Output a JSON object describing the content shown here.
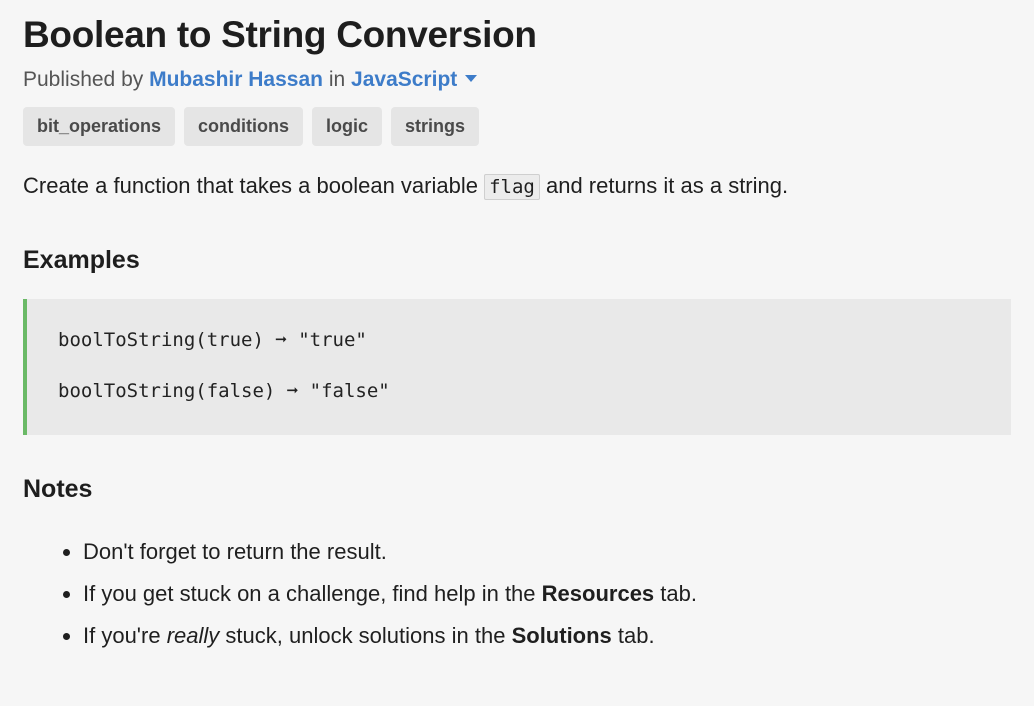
{
  "challenge": {
    "title": "Boolean to String Conversion",
    "published_prefix": "Published by",
    "author": "Mubashir Hassan",
    "in_word": "in",
    "language": "JavaScript",
    "tags": [
      "bit_operations",
      "conditions",
      "logic",
      "strings"
    ],
    "description_before": "Create a function that takes a boolean variable",
    "description_code": "flag",
    "description_after": "and returns it as a string."
  },
  "examples": {
    "heading": "Examples",
    "lines": [
      "boolToString(true) ➞ \"true\"",
      "boolToString(false) ➞ \"false\""
    ]
  },
  "notes": {
    "heading": "Notes",
    "item1": "Don't forget to return the result.",
    "item2_before": "If you get stuck on a challenge, find help in the",
    "item2_bold": "Resources",
    "item2_after": "tab.",
    "item3_before": "If you're",
    "item3_italic": "really",
    "item3_middle": "stuck, unlock solutions in the",
    "item3_bold": "Solutions",
    "item3_after": "tab."
  },
  "colors": {
    "link": "#3d7cc9",
    "code_border_accent": "#6ab966",
    "background": "#f6f6f6"
  },
  "icons": {
    "language_dropdown": "caret-down-icon"
  }
}
